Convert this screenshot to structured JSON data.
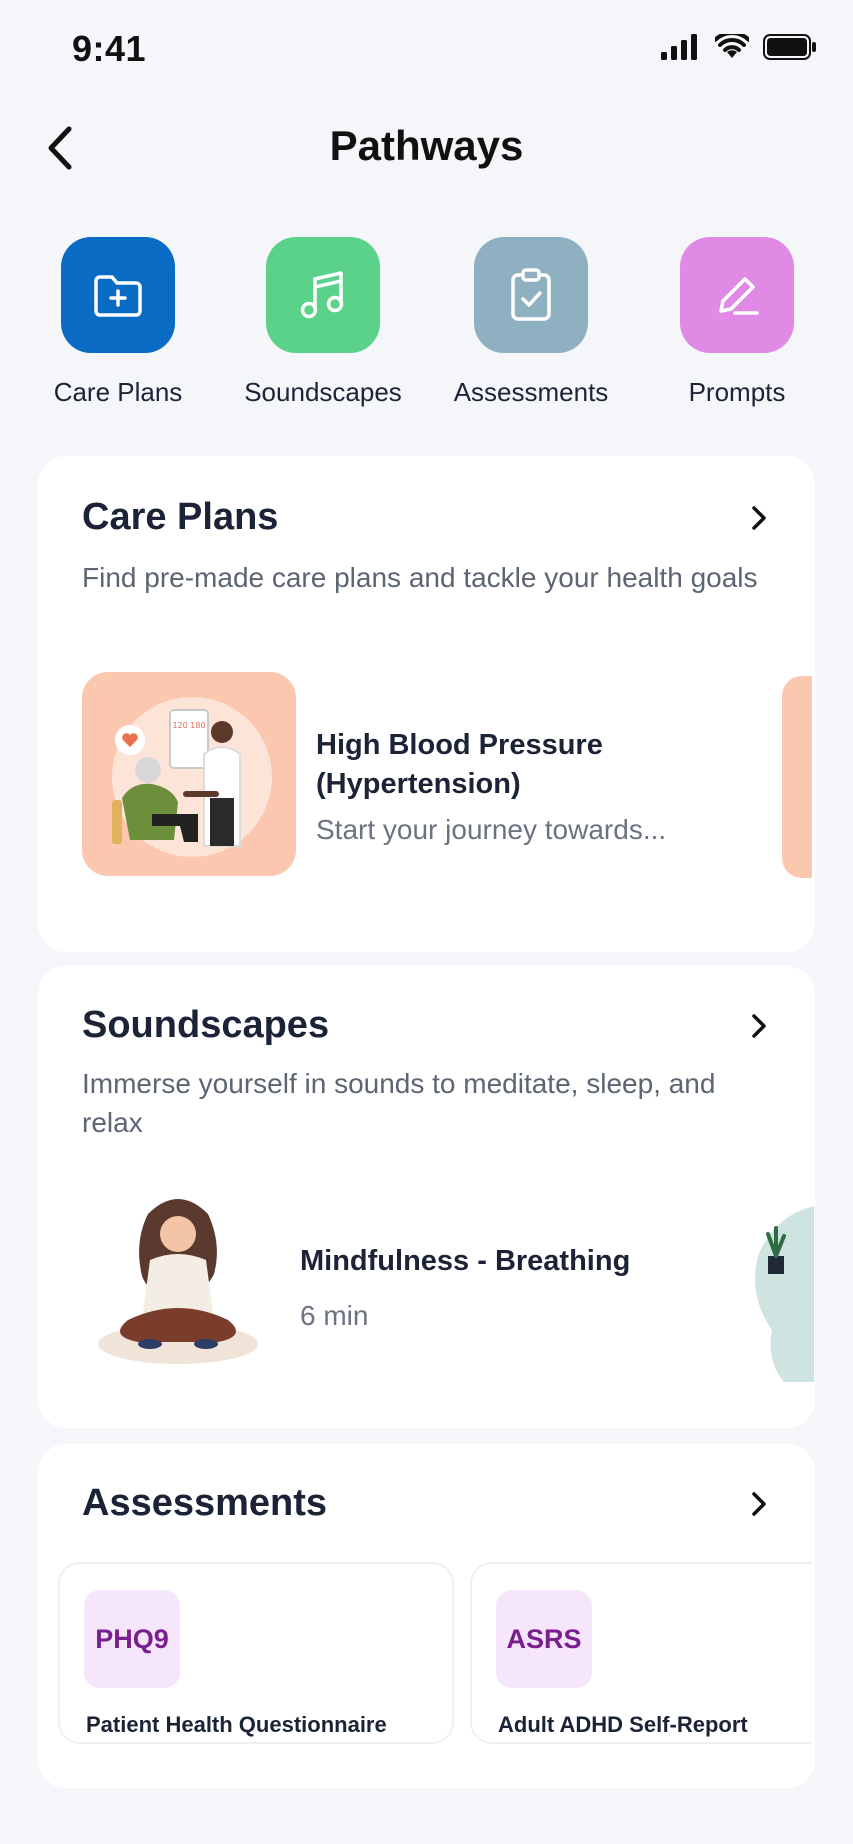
{
  "status_bar": {
    "time": "9:41"
  },
  "nav": {
    "title": "Pathways"
  },
  "quick_links": [
    {
      "label": "Care Plans",
      "icon": "folder-plus-icon",
      "color": "#0a6bc4"
    },
    {
      "label": "Soundscapes",
      "icon": "music-note-icon",
      "color": "#5ad28a"
    },
    {
      "label": "Assessments",
      "icon": "clipboard-check-icon",
      "color": "#8fb0c0"
    },
    {
      "label": "Prompts",
      "icon": "pencil-icon",
      "color": "#e08ae6"
    }
  ],
  "care_plans": {
    "title": "Care Plans",
    "description": "Find pre-made care plans and tackle your health goals",
    "item": {
      "title": "High Blood Pressure (Hypertension)",
      "subtitle": "Start your journey towards...",
      "monitor_text": "120 180"
    }
  },
  "soundscapes": {
    "title": "Soundscapes",
    "description": "Immerse yourself in sounds to meditate, sleep, and relax",
    "item": {
      "title": "Mindfulness - Breathing",
      "duration": "6 min"
    }
  },
  "assessments": {
    "title": "Assessments",
    "items": [
      {
        "badge": "PHQ9",
        "label": "Patient Health Questionnaire"
      },
      {
        "badge": "ASRS",
        "label": "Adult ADHD Self-Report"
      }
    ]
  },
  "colors": {
    "background": "#f5f6fa",
    "tile_peach": "#fbc7ae",
    "badge_bg": "#f6e6fb",
    "badge_text": "#7a1f8f"
  }
}
